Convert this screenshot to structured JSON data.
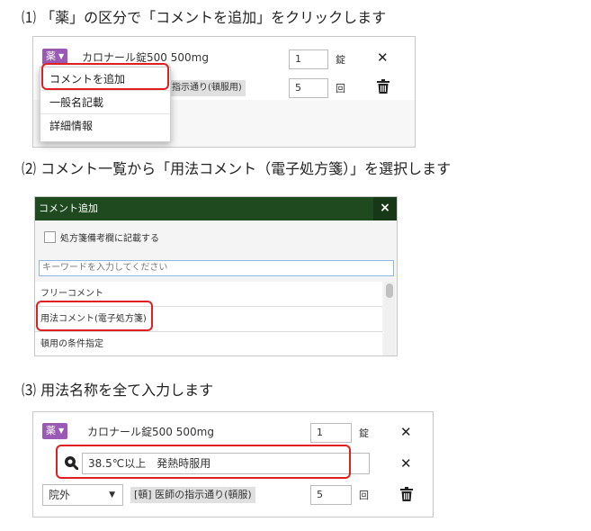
{
  "steps": {
    "step1": "⑴ 「薬」の区分で「コメントを追加」をクリックします",
    "step2": "⑵ コメント一覧から「用法コメント（電子処方箋）」を選択します",
    "step3": "⑶ 用法名称を全て入力します"
  },
  "panel1": {
    "badge": "薬",
    "drug_name": "カロナール錠500 500mg",
    "qty": "1",
    "qty_unit": "錠",
    "times": "5",
    "times_unit": "回",
    "usage_partial": "指示通り(頓服用)",
    "menu": [
      "コメントを追加",
      "一般名記載",
      "詳細情報"
    ]
  },
  "panel2": {
    "title": "コメント追加",
    "close": "×",
    "checkbox_label": "処方箋備考欄に記載する",
    "search_placeholder": "キーワードを入力してください",
    "items": [
      "フリーコメント",
      "用法コメント(電子処方箋)",
      "頓用の条件指定"
    ]
  },
  "panel3": {
    "badge": "薬",
    "drug_name": "カロナール錠500 500mg",
    "qty": "1",
    "qty_unit": "錠",
    "comment_value": "38.5℃以上　発熱時服用",
    "location_select": "院外",
    "usage_tag": "[頓] 医師の指示通り(頓服)",
    "times": "5",
    "times_unit": "回"
  },
  "colors": {
    "accent_purple": "#9b59b6",
    "highlight_red": "#e02020",
    "dialog_green": "#1f4a1f"
  }
}
